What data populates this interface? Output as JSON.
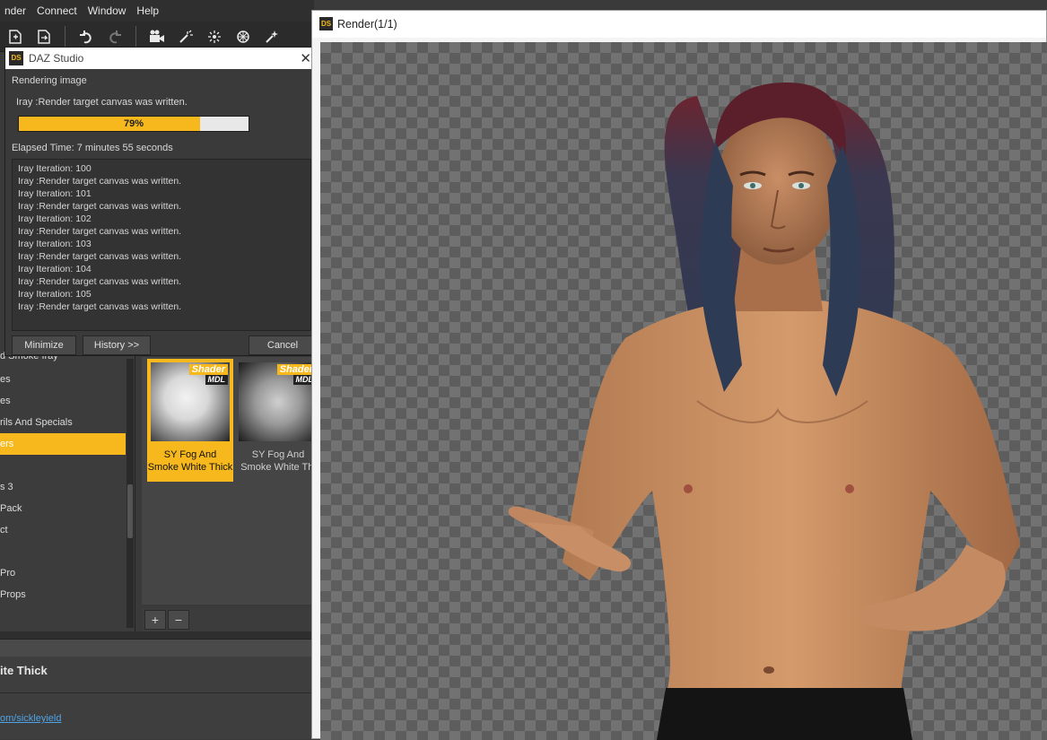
{
  "menubar": {
    "items": [
      "nder",
      "Connect",
      "Window",
      "Help"
    ]
  },
  "toolbar": {
    "icons": [
      "new-scene-icon",
      "merge-icon",
      "undo-icon",
      "redo-icon",
      "camera-icon",
      "light-icon",
      "spotlight-icon",
      "sun-icon",
      "wand-icon"
    ]
  },
  "dialog": {
    "title": "DAZ Studio",
    "close": "✕",
    "status": "Rendering image",
    "message": "Iray :Render target canvas was written.",
    "progress_percent": 79,
    "progress_label": "79%",
    "elapsed": "Elapsed Time:  7 minutes 55 seconds",
    "log": [
      "Iray Iteration: 100",
      "Iray :Render target canvas was written.",
      "Iray Iteration: 101",
      "Iray :Render target canvas was written.",
      "Iray Iteration: 102",
      "Iray :Render target canvas was written.",
      "Iray Iteration: 103",
      "Iray :Render target canvas was written.",
      "Iray Iteration: 104",
      "Iray :Render target canvas was written.",
      "Iray Iteration: 105",
      "Iray :Render target canvas was written."
    ],
    "minimize_label": "Minimize",
    "history_label": "History >>",
    "cancel_label": "Cancel"
  },
  "categories": [
    "d Smoke Iray",
    "es",
    "es",
    "rils And Specials",
    "ers",
    "",
    "s 3",
    "Pack",
    "ct",
    "",
    "Pro",
    "Props"
  ],
  "selected_category_index": 4,
  "tiles": [
    {
      "badge": "Shader",
      "badge2": "MDL",
      "label1": "SY Fog And",
      "label2": "Smoke White Thick",
      "selected": true
    },
    {
      "badge": "Shader",
      "badge2": "MDL",
      "label1": "SY Fog And",
      "label2": "Smoke White Thi",
      "selected": false
    }
  ],
  "content_buttons": {
    "add": "+",
    "remove": "−"
  },
  "info": {
    "title": "ite Thick",
    "link": "om/sickleyield"
  },
  "render_window": {
    "title": "Render(1/1)",
    "ds_badge": "DS"
  },
  "colors": {
    "accent": "#f6b81c",
    "panel": "#3a3a3a",
    "link": "#4ea3e6"
  }
}
